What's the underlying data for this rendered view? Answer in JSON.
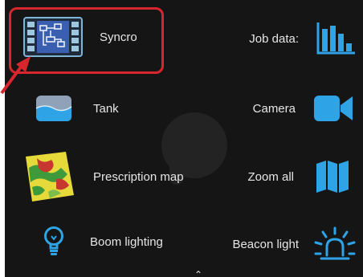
{
  "menu": {
    "left": [
      {
        "id": "syncro",
        "label": "Syncro",
        "icon": "syncro-icon"
      },
      {
        "id": "tank",
        "label": "Tank",
        "icon": "tank-icon"
      },
      {
        "id": "prescription-map",
        "label": "Prescription map",
        "icon": "prescription-map-icon"
      },
      {
        "id": "boom-lighting",
        "label": "Boom lighting",
        "icon": "light-bulb-icon"
      }
    ],
    "right": [
      {
        "id": "job-data",
        "label": "Job data:",
        "icon": "bar-chart-icon"
      },
      {
        "id": "camera",
        "label": "Camera",
        "icon": "video-camera-icon"
      },
      {
        "id": "zoom-all",
        "label": "Zoom all",
        "icon": "map-icon"
      },
      {
        "id": "beacon-light",
        "label": "Beacon light",
        "icon": "beacon-light-icon"
      }
    ]
  },
  "colors": {
    "background": "#151515",
    "text": "#e6e6e6",
    "accent_blue": "#2ea3e6",
    "highlight_red": "#d8262e"
  },
  "annotation": {
    "highlighted_item": "syncro",
    "pointer_icon": "arrow-icon"
  },
  "footer": {
    "caret_icon": "chevron-up-icon"
  }
}
